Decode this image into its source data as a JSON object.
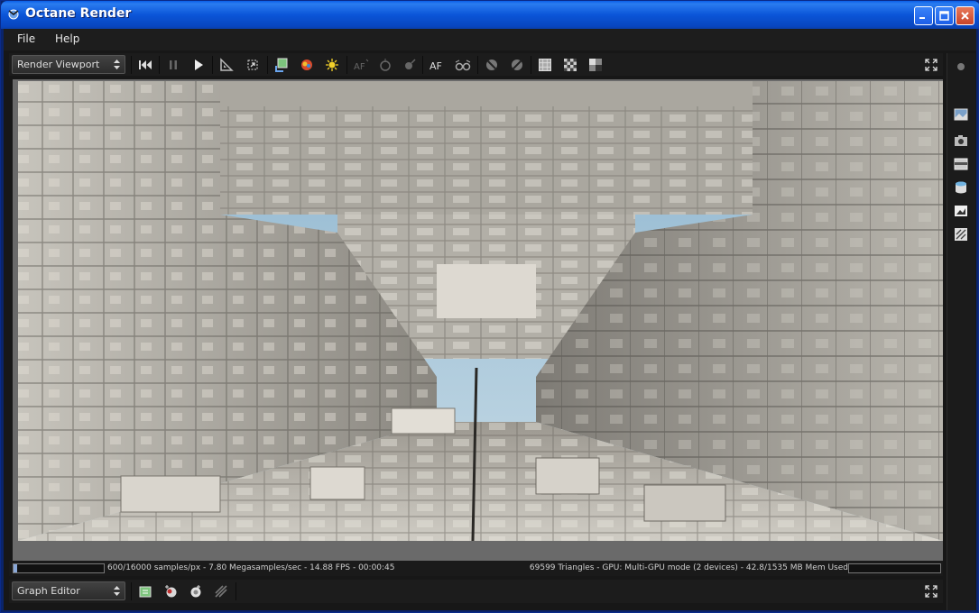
{
  "window": {
    "title": "Octane Render"
  },
  "menu": {
    "file": "File",
    "help": "Help"
  },
  "viewport_toolbar": {
    "combo_label": "Render Viewport"
  },
  "status": {
    "left_text": "600/16000 samples/px - 7.80 Megasamples/sec - 14.88 FPS - 00:00:45",
    "right_text": "69599 Triangles - GPU: Multi-GPU mode (2 devices) - 42.8/1535 MB Mem Used",
    "progress": 0.0375
  },
  "graph_toolbar": {
    "combo_label": "Graph Editor"
  },
  "icons": {
    "viewport_toolbar": [
      "skip-to-start-icon",
      "pause-icon",
      "play-icon",
      "set-square-icon",
      "fit-view-icon",
      "export-passes-icon",
      "color-picker-icon",
      "light-pick-icon",
      "autofocus-pick-icon",
      "white-balance-icon",
      "material-pick-icon",
      "af-toggle-icon",
      "stereo-glasses-icon",
      "region-render-icon",
      "film-region-icon",
      "grid-overlay-icon",
      "checker-icon",
      "lock-view-icon",
      "fullscreen-icon"
    ],
    "graph_toolbar": [
      "load-scene-icon",
      "add-mesh-icon",
      "add-material-icon",
      "add-texture-icon",
      "fullscreen-icon"
    ],
    "right_panel": [
      "indicator-dot-icon",
      "image-icon",
      "camera-icon",
      "panel-icon",
      "database-icon",
      "picture-icon",
      "settings-icon"
    ]
  },
  "colors": {
    "titlebar": "#0a5fe8",
    "background": "#171717",
    "sky": "#a7c6db",
    "stone": "#b5b2aa"
  }
}
